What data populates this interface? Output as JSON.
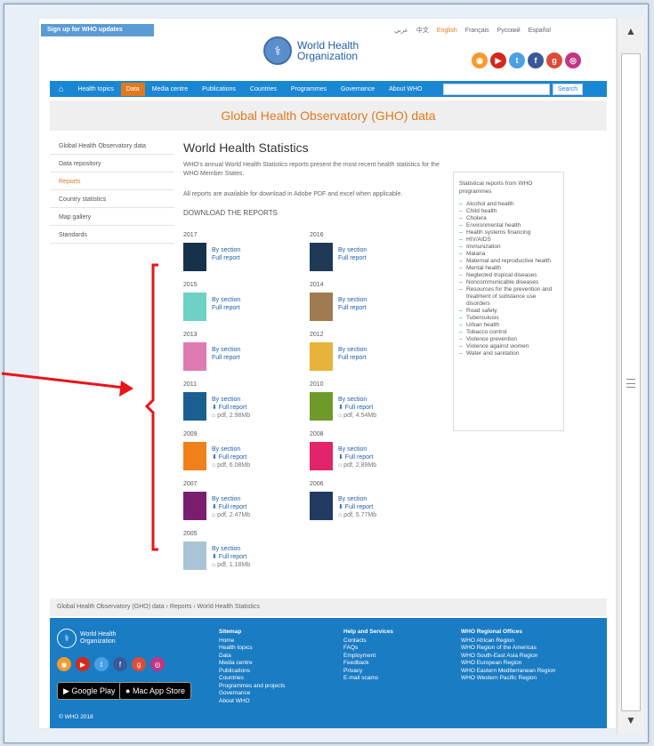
{
  "header": {
    "signup": "Sign up for WHO updates",
    "languages": [
      "عربي",
      "中文",
      "English",
      "Français",
      "Русский",
      "Español"
    ],
    "active_language": "English",
    "logo_line1": "World Health",
    "logo_line2": "Organization"
  },
  "nav": {
    "items": [
      "Health topics",
      "Data",
      "Media centre",
      "Publications",
      "Countries",
      "Programmes",
      "Governance",
      "About WHO"
    ],
    "selected": "Data",
    "search_button": "Search"
  },
  "banner": "Global Health Observatory (GHO) data",
  "sidebar": {
    "items": [
      "Global Health Observatory data",
      "Data repository",
      "Reports",
      "Country statistics",
      "Map gallery",
      "Standards"
    ],
    "current": "Reports"
  },
  "main": {
    "title": "World Health Statistics",
    "intro": "WHO's annual World Health Statistics reports present the most recent health statistics for the WHO Member States.",
    "availability": "All reports are available for download in Adobe PDF and excel when applicable.",
    "download_heading": "DOWNLOAD THE REPORTS",
    "reports": [
      {
        "year": "2017",
        "l1": "By section",
        "l2": "Full report",
        "l3": "",
        "cover": "#16324a"
      },
      {
        "year": "2016",
        "l1": "By section",
        "l2": "Full report",
        "l3": "",
        "cover": "#1e3a55"
      },
      {
        "year": "2015",
        "l1": "By section",
        "l2": "Full report",
        "l3": "",
        "cover": "#6fd1c3"
      },
      {
        "year": "2014",
        "l1": "By section",
        "l2": "Full report",
        "l3": "",
        "cover": "#a07b50"
      },
      {
        "year": "2013",
        "l1": "By section",
        "l2": "Full report",
        "l3": "",
        "cover": "#e07ab2"
      },
      {
        "year": "2012",
        "l1": "By section",
        "l2": "Full report",
        "l3": "",
        "cover": "#e8b33a"
      },
      {
        "year": "2011",
        "l1": "By section",
        "l2": "Full report",
        "l3": "pdf, 2.98Mb",
        "cover": "#1b5f92"
      },
      {
        "year": "2010",
        "l1": "By section",
        "l2": "Full report",
        "l3": "pdf, 4.54Mb",
        "cover": "#6e9a2a"
      },
      {
        "year": "2009",
        "l1": "By section",
        "l2": "Full report",
        "l3": "pdf, 6.08Mb",
        "cover": "#f08019"
      },
      {
        "year": "2008",
        "l1": "By section",
        "l2": "Full report",
        "l3": "pdf, 2.89Mb",
        "cover": "#e3246b"
      },
      {
        "year": "2007",
        "l1": "By section",
        "l2": "Full report",
        "l3": "pdf, 2.47Mb",
        "cover": "#7a1f6e"
      },
      {
        "year": "2006",
        "l1": "By section",
        "l2": "Full report",
        "l3": "pdf, 5.77Mb",
        "cover": "#233a63"
      },
      {
        "year": "2005",
        "l1": "By section",
        "l2": "Full report",
        "l3": "pdf, 1.18Mb",
        "cover": "#a8c4d6"
      }
    ]
  },
  "programmes": {
    "heading": "Statistical reports from WHO programmes",
    "items": [
      "Alcohol and health",
      "Child health",
      "Cholera",
      "Environmental health",
      "Health systems financing",
      "HIV/AIDS",
      "Immunization",
      "Malaria",
      "Maternal and reproductive health",
      "Mental health",
      "Neglected tropical diseases",
      "Noncommunicable diseases",
      "Resources for the prevention and treatment of substance use disorders",
      "Road safety",
      "Tuberculosis",
      "Urban health",
      "Tobacco control",
      "Violence prevention",
      "Violence against women",
      "Water and sanitation"
    ]
  },
  "breadcrumb": "Global Health Observatory (GHO) data › Reports › World Health Statistics",
  "footer": {
    "logo_line1": "World Health",
    "logo_line2": "Organization",
    "google_play": "Google Play",
    "app_store": "Mac App Store",
    "copyright": "© WHO 2018",
    "col1": [
      "Sitemap",
      "Home",
      "Health topics",
      "Data",
      "Media centre",
      "Publications",
      "Countries",
      "Programmes and projects",
      "Governance",
      "About WHO"
    ],
    "col2": [
      "Help and Services",
      "Contacts",
      "FAQs",
      "Employment",
      "Feedback",
      "Privacy",
      "E-mail scams"
    ],
    "col3": [
      "WHO Regional Offices",
      "WHO African Region",
      "WHO Region of the Americas",
      "WHO South-East Asia Region",
      "WHO European Region",
      "WHO Eastern Mediterranean Region",
      "WHO Western Pacific Region"
    ]
  },
  "colors": {
    "accent": "#e07a1f",
    "brand": "#1a87d3",
    "annotation": "#e8141a"
  }
}
